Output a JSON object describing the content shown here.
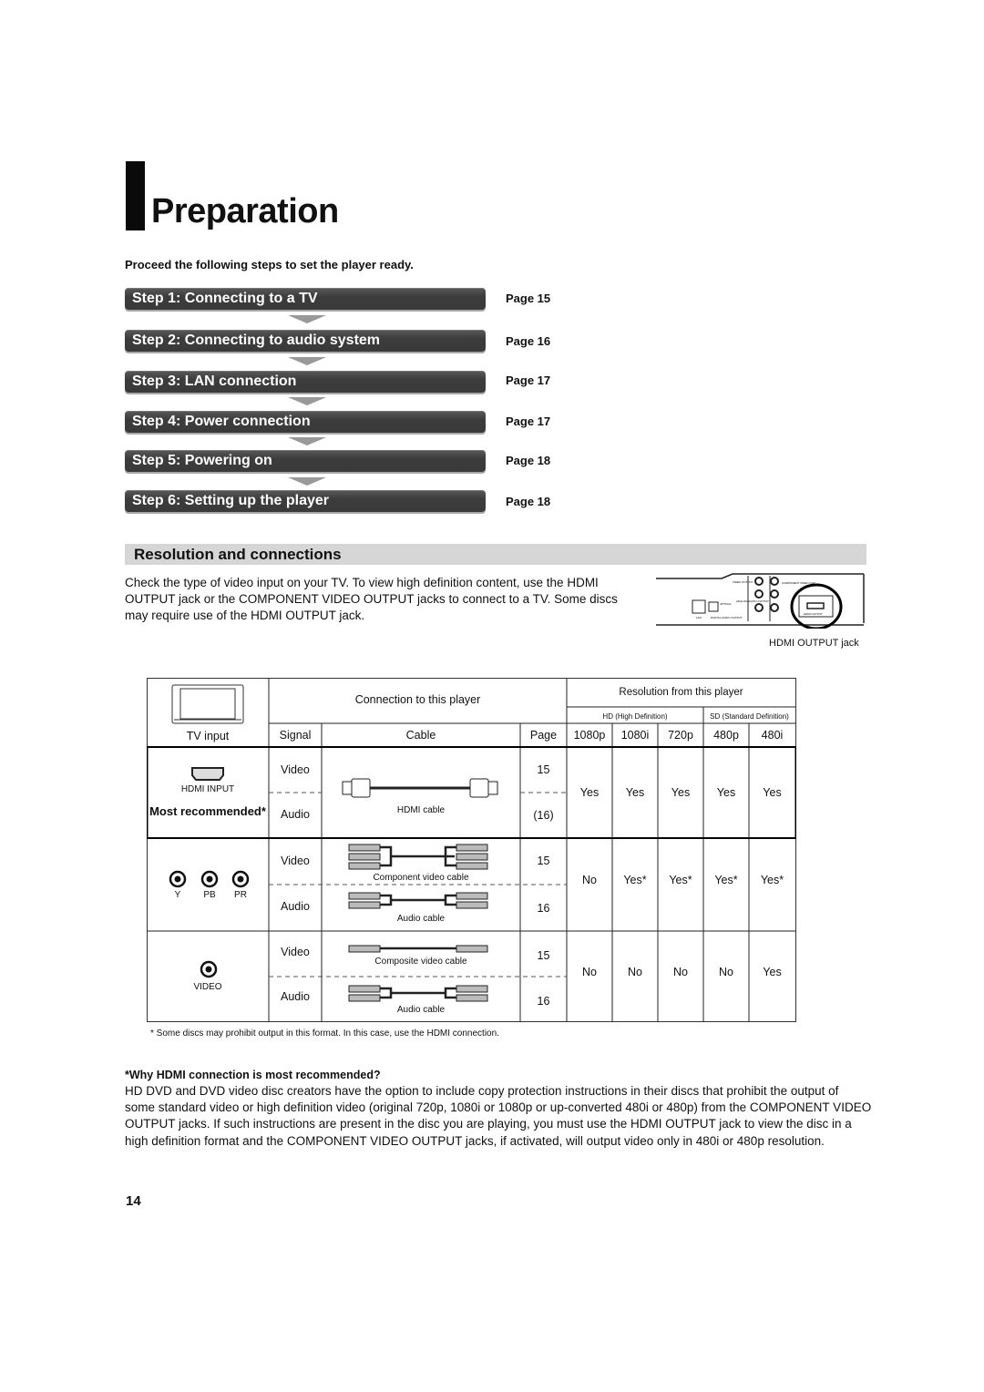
{
  "page": {
    "title": "Preparation",
    "intro": "Proceed the following steps to set the player ready.",
    "page_number": "14"
  },
  "steps": [
    {
      "label": "Step 1: Connecting to a TV",
      "page": "Page 15"
    },
    {
      "label": "Step 2: Connecting to audio system",
      "page": "Page 16"
    },
    {
      "label": "Step 3: LAN connection",
      "page": "Page 17"
    },
    {
      "label": "Step 4: Power connection",
      "page": "Page 17"
    },
    {
      "label": "Step 5: Powering on",
      "page": "Page 18"
    },
    {
      "label": "Step 6: Setting up the player",
      "page": "Page 18"
    }
  ],
  "resolution_section": {
    "title": "Resolution and connections",
    "description": "Check the type of video input on your TV. To view high definition content, use the HDMI OUTPUT jack or the COMPONENT VIDEO OUTPUT jacks to connect to a TV. Some discs may require use of the HDMI OUTPUT jack.",
    "jack_caption": "HDMI OUTPUT jack",
    "panel_labels": {
      "video_output": "VIDEO OUTPUT",
      "component": "COMPONENT VIDEO OUT",
      "analog_audio": "ANALOG AUDIO OUTPUT",
      "lan": "LAN",
      "digital_audio": "DIGITAL AUDIO OUTPUT",
      "optical": "OPTICAL",
      "hdmi_output": "HDMI OUTPUT"
    }
  },
  "table": {
    "headers": {
      "tv_input": "TV input",
      "connection": "Connection to this player",
      "resolution": "Resolution from this player",
      "hd_group": "HD (High Definition)",
      "sd_group": "SD (Standard Definition)",
      "signal": "Signal",
      "cable": "Cable",
      "page": "Page",
      "resolutions": [
        "1080p",
        "1080i",
        "720p",
        "480p",
        "480i"
      ]
    },
    "rows": [
      {
        "tv_input": "HDMI INPUT",
        "note": "Most recommended*",
        "signals": [
          "Video",
          "Audio"
        ],
        "cable": "HDMI cable",
        "pages": [
          "15",
          "(16)"
        ],
        "values": [
          "Yes",
          "Yes",
          "Yes",
          "Yes",
          "Yes"
        ]
      },
      {
        "tv_input_labels": [
          "Y",
          "PB",
          "PR"
        ],
        "signals": [
          "Video",
          "Audio"
        ],
        "cables": [
          "Component video cable",
          "Audio cable"
        ],
        "pages": [
          "15",
          "16"
        ],
        "values": [
          "No",
          "Yes*",
          "Yes*",
          "Yes*",
          "Yes*"
        ]
      },
      {
        "tv_input": "VIDEO",
        "signals": [
          "Video",
          "Audio"
        ],
        "cables": [
          "Composite video cable",
          "Audio cable"
        ],
        "pages": [
          "15",
          "16"
        ],
        "values": [
          "No",
          "No",
          "No",
          "No",
          "Yes"
        ]
      }
    ],
    "footnote": "* Some discs may prohibit output in this format. In this case, use the HDMI connection."
  },
  "why": {
    "title": "*Why HDMI connection is most recommended?",
    "body": "HD DVD and DVD video disc creators have the option to include copy protection instructions in their discs that prohibit the output of some standard video or high definition video (original 720p, 1080i or 1080p or up-converted 480i or 480p) from the COMPONENT VIDEO OUTPUT jacks. If such instructions are present in the disc you are playing, you must use the HDMI OUTPUT jack to view the disc in a high definition format and the COMPONENT VIDEO OUTPUT jacks, if activated, will output video only in 480i or 480p resolution."
  }
}
